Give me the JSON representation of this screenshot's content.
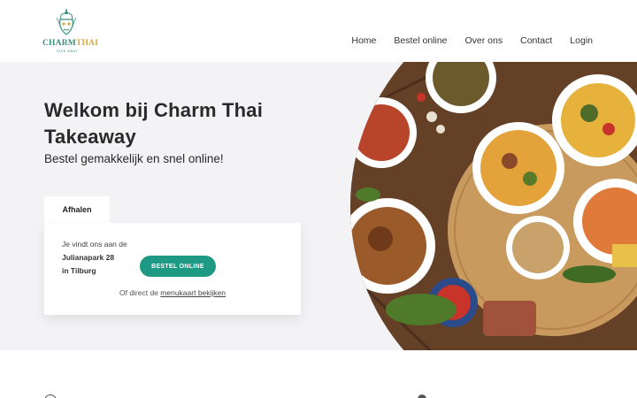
{
  "brand": {
    "name_part1": "CHARM",
    "name_part2": "THAI",
    "tagline": "TAKE AWAY"
  },
  "nav": {
    "items": [
      "Home",
      "Bestel online",
      "Over ons",
      "Contact",
      "Login"
    ]
  },
  "hero": {
    "title": "Welkom bij Charm Thai Takeaway",
    "subtitle": "Bestel gemakkelijk en snel online!"
  },
  "order": {
    "tab_label": "Afhalen",
    "address_intro": "Je vindt ons aan de",
    "address_line1": "Julianapark 28",
    "address_line2": "in Tilburg",
    "button_label": "BESTEL ONLINE",
    "menu_prefix": "Of direct de",
    "menu_link": "menukaart bekijken"
  },
  "colors": {
    "accent": "#1e9a84",
    "brand_green": "#3a8f80",
    "brand_gold": "#d2a84a",
    "hero_bg": "#f3f3f5"
  },
  "icons": {
    "lower_left": "clock-icon",
    "lower_right": "location-pin-icon"
  }
}
